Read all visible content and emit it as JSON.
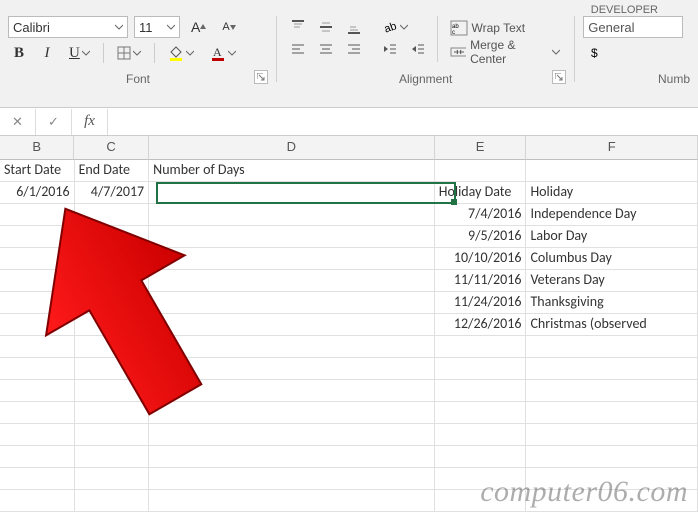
{
  "ribbon": {
    "font": {
      "name": "Calibri",
      "size": "11",
      "incA": "A",
      "decA": "A",
      "bold": "B",
      "italic": "I",
      "underline": "U",
      "group_label": "Font",
      "font_color": "#c00000",
      "fill_color": "#ffff00"
    },
    "alignment": {
      "wrap": "Wrap Text",
      "merge": "Merge & Center",
      "group_label": "Alignment"
    },
    "number": {
      "format": "General",
      "group_label": "Numb"
    },
    "tab_dev": "DEVELOPER"
  },
  "formula_bar": {
    "cancel": "✕",
    "enter": "✓",
    "fx": "fx",
    "value": ""
  },
  "columns": {
    "B": "B",
    "C": "C",
    "D": "D",
    "E": "E",
    "F": "F"
  },
  "rows": [
    {
      "B": "Start Date",
      "C": "End Date",
      "D": "Number of Days",
      "E": "",
      "F": ""
    },
    {
      "B": "6/1/2016",
      "C": "4/7/2017",
      "D": "",
      "E": "Holiday Date",
      "F": "Holiday"
    },
    {
      "B": "",
      "C": "",
      "D": "",
      "E": "7/4/2016",
      "F": "Independence Day"
    },
    {
      "B": "",
      "C": "",
      "D": "",
      "E": "9/5/2016",
      "F": "Labor Day"
    },
    {
      "B": "",
      "C": "",
      "D": "",
      "E": "10/10/2016",
      "F": "Columbus Day"
    },
    {
      "B": "",
      "C": "",
      "D": "",
      "E": "11/11/2016",
      "F": "Veterans Day"
    },
    {
      "B": "",
      "C": "",
      "D": "",
      "E": "11/24/2016",
      "F": "Thanksgiving"
    },
    {
      "B": "",
      "C": "",
      "D": "",
      "E": "12/26/2016",
      "F": "Christmas (observed"
    }
  ],
  "watermark": "computer06.com"
}
